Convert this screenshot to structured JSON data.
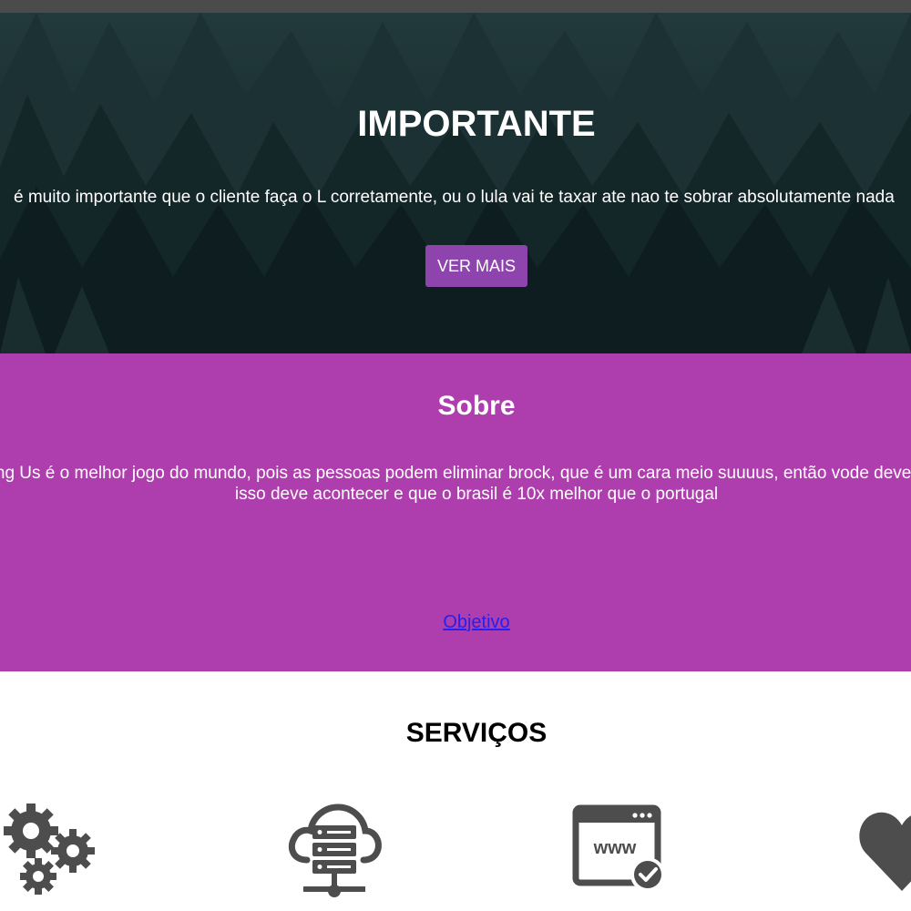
{
  "hero": {
    "title": "IMPORTANTE",
    "text": "é muito importante que o cliente faça o L corretamente, ou o lula vai te taxar ate nao te sobrar absolutamente nada",
    "button_label": "VER MAIS"
  },
  "sobre": {
    "title": "Sobre",
    "text_line1": "Among Us é o melhor jogo do mundo, pois as pessoas podem eliminar brock, que é um cara meio suuuus, então vode deve saber que",
    "text_line2": "isso deve acontecer e que o brasil é 10x melhor que o portugal",
    "link_label": "Objetivo"
  },
  "servicos": {
    "title": "SERVIÇOS",
    "icons": [
      "gears-icon",
      "cloud-server-icon",
      "www-check-icon",
      "heart-icon"
    ],
    "icon_color": "#4d4d4d"
  },
  "colors": {
    "topbar": "#4b4b4b",
    "button": "#8e44ad",
    "sobre_bg": "#ae3ead",
    "link": "#2a1ee8"
  }
}
